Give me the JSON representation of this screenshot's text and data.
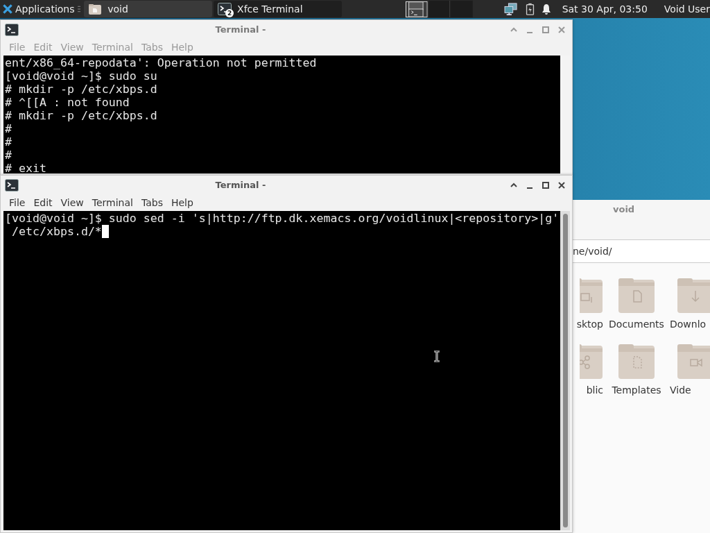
{
  "panel": {
    "app_menu": "Applications",
    "tasks": [
      {
        "label": "void",
        "kind": "folder",
        "selected": true
      },
      {
        "label": "Xfce Terminal",
        "kind": "terminal",
        "badge": "2",
        "selected": false
      }
    ],
    "clock": "Sat 30 Apr, 03:50",
    "user": "Void User"
  },
  "terminals": [
    {
      "title": "Terminal -",
      "focused": false,
      "menu": [
        "File",
        "Edit",
        "View",
        "Terminal",
        "Tabs",
        "Help"
      ],
      "cursor": false,
      "lines": [
        "ent/x86_64-repodata': Operation not permitted",
        "[void@void ~]$ sudo su",
        "# mkdir -p /etc/xbps.d",
        "# ^[[A : not found",
        "# mkdir -p /etc/xbps.d",
        "#",
        "#",
        "#",
        "# exit"
      ]
    },
    {
      "title": "Terminal -",
      "focused": true,
      "menu": [
        "File",
        "Edit",
        "View",
        "Terminal",
        "Tabs",
        "Help"
      ],
      "cursor": true,
      "lines": [
        "[void@void ~]$ sudo sed -i 's|http://ftp.dk.xemacs.org/voidlinux|<repository>|g'",
        " /etc/xbps.d/*"
      ]
    }
  ],
  "file_manager": {
    "title": "void",
    "path": "ne/void/",
    "items": [
      {
        "label": "sktop",
        "kind": "desktop"
      },
      {
        "label": "Documents",
        "kind": "document"
      },
      {
        "label": "Downlo",
        "kind": "download"
      },
      {
        "label": "blic",
        "kind": "share"
      },
      {
        "label": "Templates",
        "kind": "template"
      },
      {
        "label": "Vide",
        "kind": "video"
      }
    ]
  }
}
